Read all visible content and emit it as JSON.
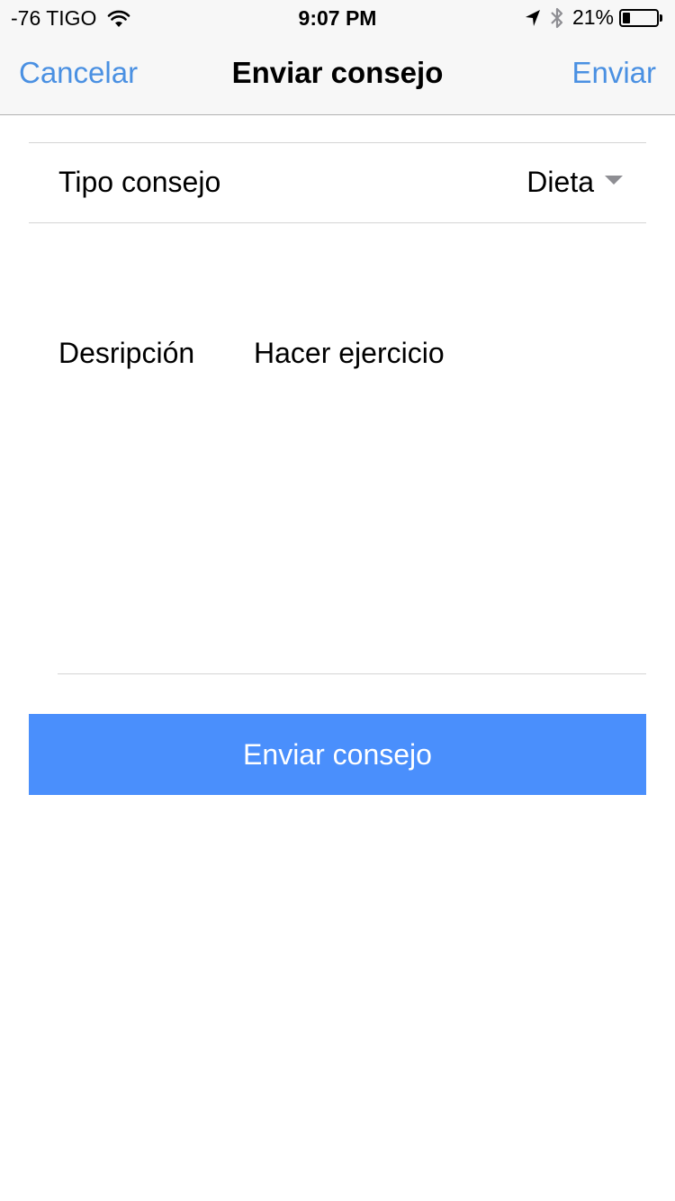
{
  "status_bar": {
    "carrier": "-76 TIGO",
    "time": "9:07 PM",
    "battery_percent": "21%",
    "battery_level": 0.21,
    "icons": [
      "wifi-icon",
      "location-arrow-icon",
      "bluetooth-icon",
      "battery-icon"
    ]
  },
  "nav": {
    "cancel_label": "Cancelar",
    "title": "Enviar consejo",
    "send_label": "Enviar"
  },
  "form": {
    "type_label": "Tipo consejo",
    "type_value": "Dieta",
    "description_label": "Desripción",
    "description_value": "Hacer ejercicio"
  },
  "submit_label": "Enviar consejo",
  "colors": {
    "accent": "#4a90e2",
    "button": "#4a8ffc"
  }
}
